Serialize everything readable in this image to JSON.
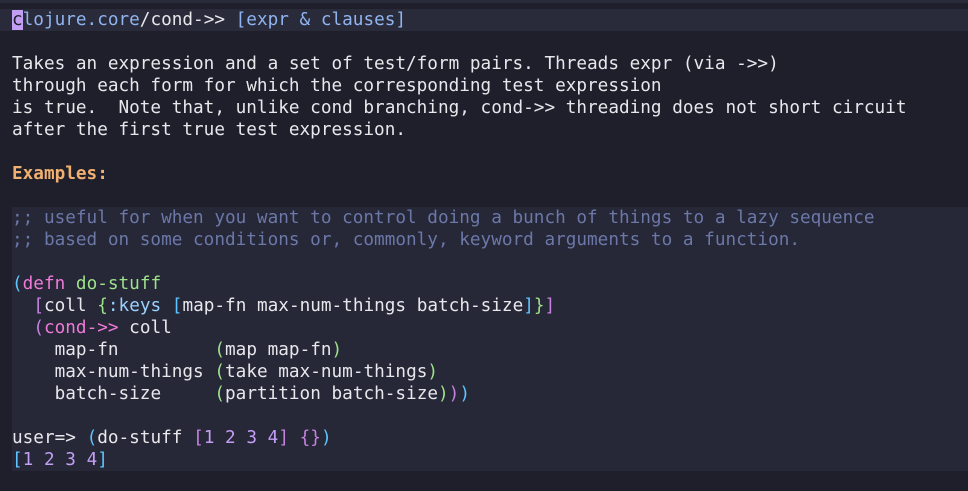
{
  "header": {
    "cursor_char": "c",
    "namespace_rest": "lojure.core",
    "slash": "/",
    "fn_name": "cond->>",
    "arglist": "[expr & clauses]"
  },
  "doc": [
    "Takes an expression and a set of test/form pairs. Threads expr (via ->>)",
    "through each form for which the corresponding test expression",
    "is true.  Note that, unlike cond branching, cond->> threading does not short circuit",
    "after the first true test expression."
  ],
  "examples_heading": "Examples:",
  "code": {
    "comments": [
      ";; useful for when you want to control doing a bunch of things to a lazy sequence",
      ";; based on some conditions or, commonly, keyword arguments to a function."
    ],
    "defn_kw": "defn",
    "fname": "do-stuff",
    "coll": "coll",
    "keys_kw": ":keys",
    "destructure": "map-fn max-num-things batch-size",
    "cond_kw": "cond->>",
    "cond_coll": "coll",
    "clauses": [
      {
        "test": "map-fn",
        "pad": "         ",
        "form_fn": "map",
        "form_arg": "map-fn",
        "close": ")"
      },
      {
        "test": "max-num-things",
        "pad": " ",
        "form_fn": "take",
        "form_arg": "max-num-things",
        "close": ")"
      },
      {
        "test": "batch-size",
        "pad": "     ",
        "form_fn": "partition",
        "form_arg": "batch-size",
        "close": ")))"
      }
    ],
    "repl_prompt": "user=>",
    "repl_call": "do-stuff",
    "repl_vec": [
      "1",
      "2",
      "3",
      "4"
    ],
    "repl_map": "{}",
    "result": [
      "1",
      "2",
      "3",
      "4"
    ]
  }
}
